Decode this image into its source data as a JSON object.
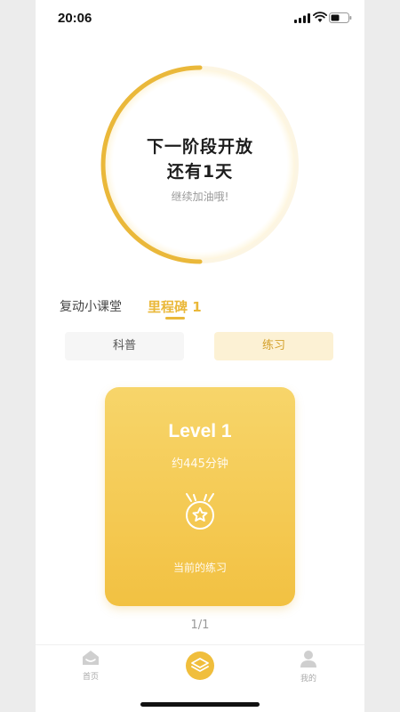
{
  "status_bar": {
    "time": "20:06"
  },
  "progress": {
    "line1": "下一阶段开放",
    "line2": "还有1天",
    "subtitle": "继续加油哦!",
    "fraction": 0.5,
    "accent": "#eab83a"
  },
  "tabs": [
    {
      "label": "复动小课堂"
    },
    {
      "label": "里程碑 1",
      "active": true
    }
  ],
  "segments": [
    {
      "label": "科普"
    },
    {
      "label": "练习",
      "active": true
    }
  ],
  "card": {
    "title": "Level 1",
    "duration": "约445分钟",
    "icon": "medal-star-icon",
    "status": "当前的练习"
  },
  "pager": "1/1",
  "tabbar": {
    "home_label": "首页",
    "center_icon": "layers-icon",
    "me_label": "我的"
  }
}
